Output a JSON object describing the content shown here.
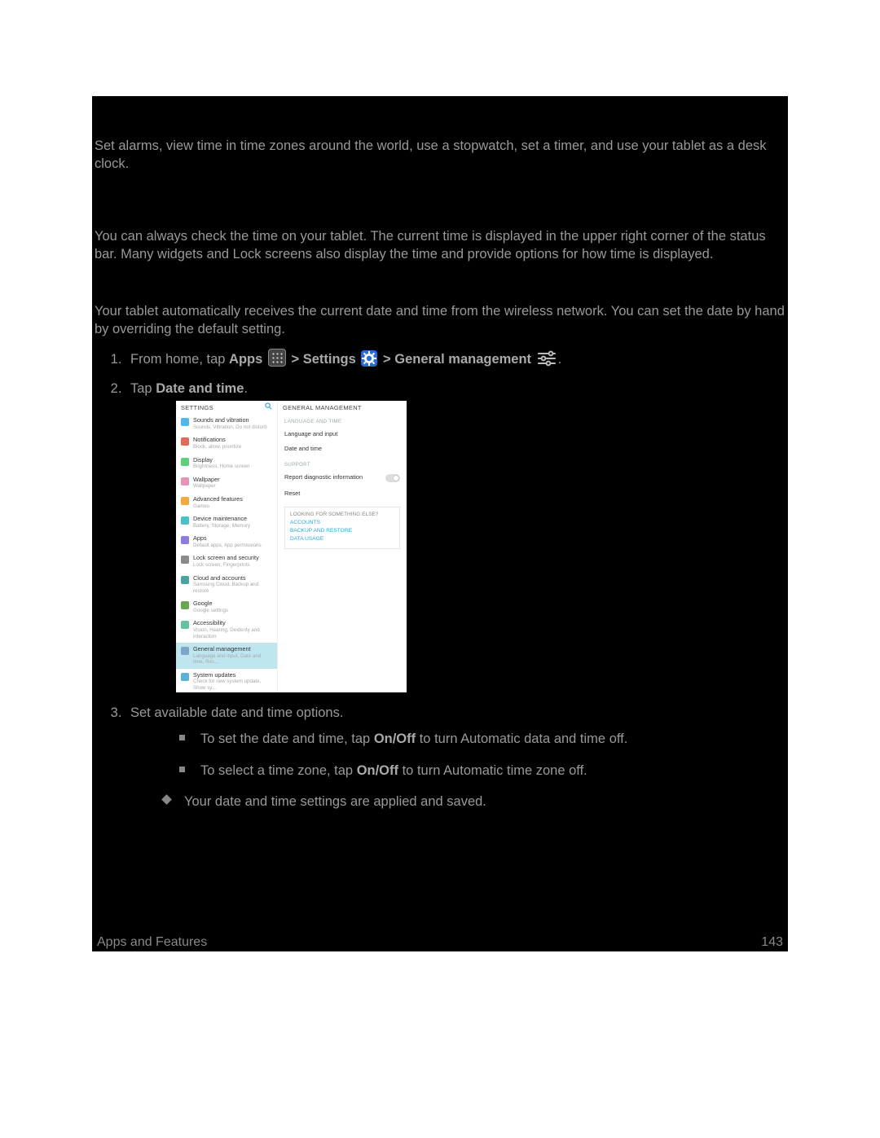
{
  "intro": "Set alarms, view time in time zones around the world, use a stopwatch, set a timer, and use your tablet as a desk clock.",
  "checkTime": "You can always check the time on your tablet. The current time is displayed in the upper right corner of the status bar. Many widgets and Lock screens also display the time and provide options for how time is displayed.",
  "setDate": "Your tablet automatically receives the current date and time from the wireless network. You can set the date by hand by overriding the default setting.",
  "step1": {
    "prefix": "From home, tap ",
    "apps": "Apps",
    "sep1": " > ",
    "settings": "Settings",
    "sep2": " > ",
    "genmgmt": "General management",
    "suffix": "."
  },
  "step2": {
    "pre": "Tap ",
    "bold": "Date and time",
    "post": "."
  },
  "step3": "Set available date and time options.",
  "bullet1": {
    "pre": "To set the date and time, tap ",
    "bold": "On/Off",
    "post": " to turn Automatic data and time off."
  },
  "bullet2": {
    "pre": "To select a time zone, tap ",
    "bold": "On/Off",
    "post": " to turn Automatic time zone off."
  },
  "result": "Your date and time settings are applied and saved.",
  "footerLeft": "Apps and Features",
  "footerRight": "143",
  "shot": {
    "leftTitle": "SETTINGS",
    "rightTitle": "GENERAL MANAGEMENT",
    "cap1": "LANGUAGE AND TIME",
    "row1": "Language and input",
    "row2": "Date and time",
    "cap2": "SUPPORT",
    "row3": "Report diagnostic information",
    "row4": "Reset",
    "boxHead": "LOOKING FOR SOMETHING ELSE?",
    "boxL1": "ACCOUNTS",
    "boxL2": "BACKUP AND RESTORE",
    "boxL3": "DATA USAGE",
    "items": [
      {
        "t": "Sounds and vibration",
        "d": "Sounds, Vibration, Do not disturb",
        "c": "#53b7e8"
      },
      {
        "t": "Notifications",
        "d": "Block, allow, prioritize",
        "c": "#e06b5b"
      },
      {
        "t": "Display",
        "d": "Brightness, Home screen",
        "c": "#5fcf7f"
      },
      {
        "t": "Wallpaper",
        "d": "Wallpaper",
        "c": "#e693b7"
      },
      {
        "t": "Advanced features",
        "d": "Games",
        "c": "#f2a93b"
      },
      {
        "t": "Device maintenance",
        "d": "Battery, Storage, Memory",
        "c": "#49c1c9"
      },
      {
        "t": "Apps",
        "d": "Default apps, App permissions",
        "c": "#8f7be0"
      },
      {
        "t": "Lock screen and security",
        "d": "Lock screen, Fingerprints",
        "c": "#8a8a8a"
      },
      {
        "t": "Cloud and accounts",
        "d": "Samsung Cloud, Backup and restore",
        "c": "#4aa3a3"
      },
      {
        "t": "Google",
        "d": "Google settings",
        "c": "#6aa84f"
      },
      {
        "t": "Accessibility",
        "d": "Vision, Hearing, Dexterity and interaction",
        "c": "#63c3a0"
      },
      {
        "t": "General management",
        "d": "Language and input, Date and time, Res...",
        "c": "#7aa7c7",
        "sel": true
      },
      {
        "t": "System updates",
        "d": "Check for new system update, Show sy...",
        "c": "#5bb0d9"
      }
    ]
  }
}
